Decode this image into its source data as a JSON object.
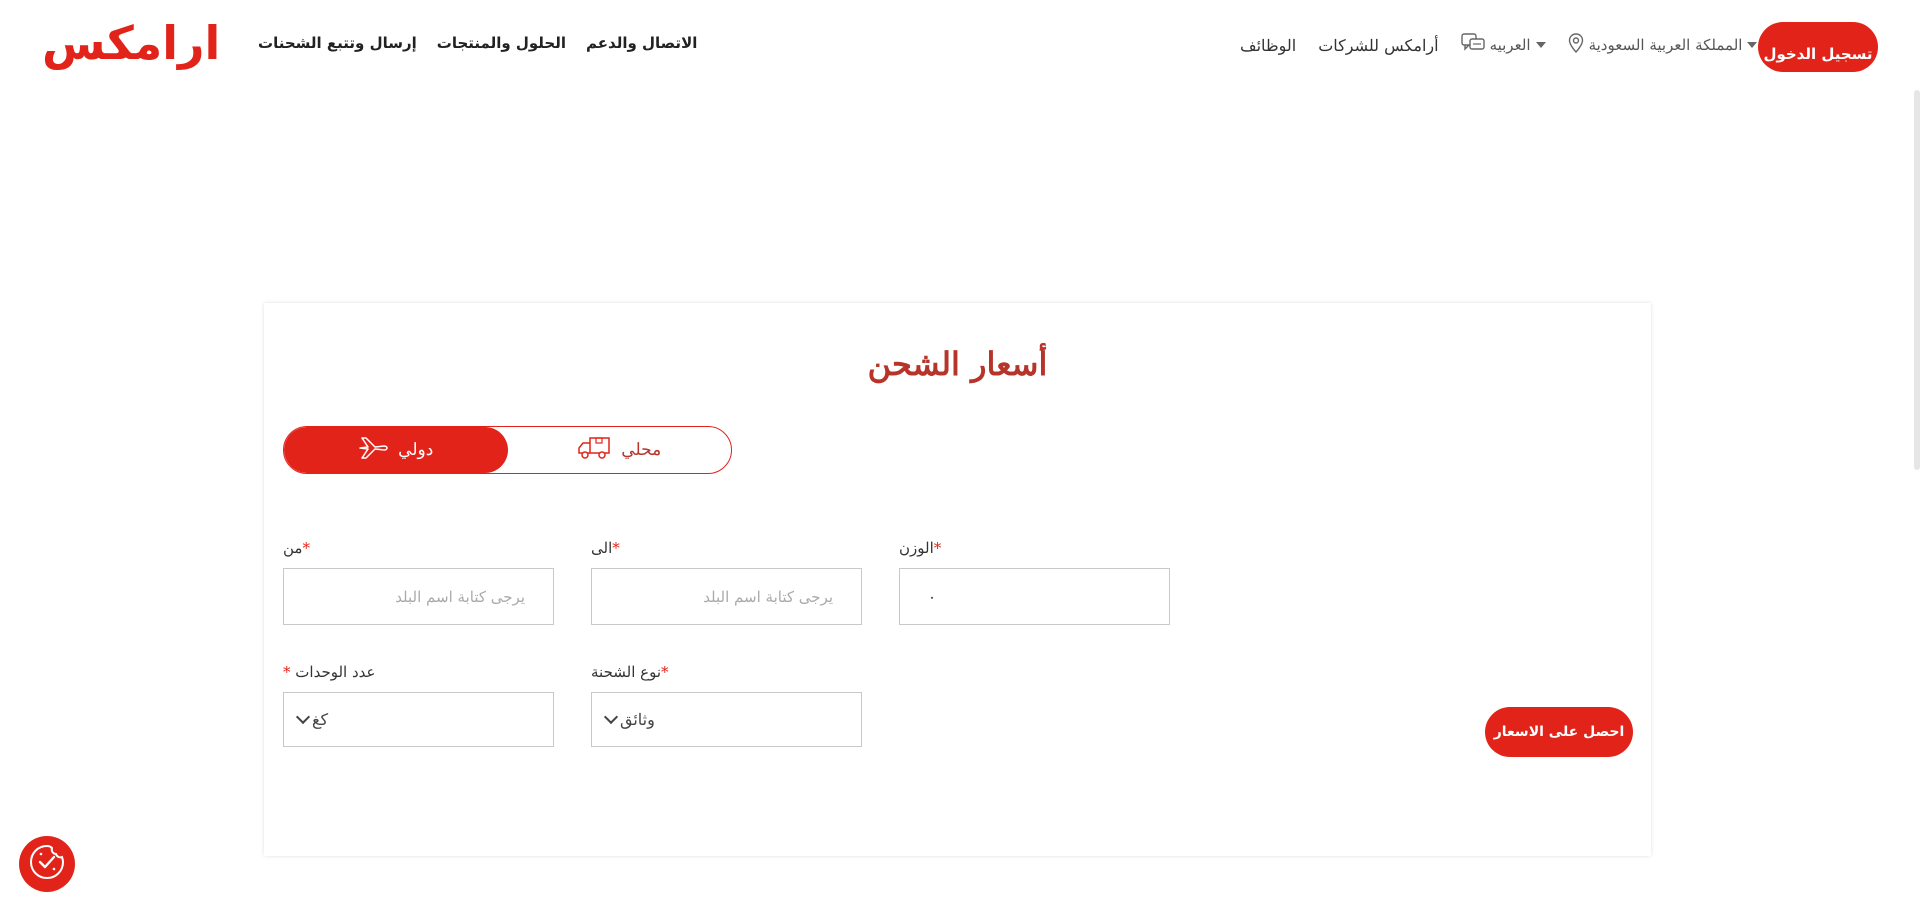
{
  "header": {
    "logo_text": "ارامكس",
    "main_nav": [
      "إرسال وتتبع الشحنات",
      "الحلول والمنتجات",
      "الاتصال والدعم"
    ],
    "util_links": {
      "jobs": "الوظائف",
      "business": "أرامكس للشركات",
      "language": "العربيه",
      "country": "المملكة العربية السعودية"
    },
    "login_label": "تسجيل الدخول"
  },
  "form": {
    "title": "أسعار الشحن",
    "toggle": {
      "international": "دولي",
      "domestic": "محلي",
      "selected": "international"
    },
    "from": {
      "label": "من",
      "placeholder": "يرجى كتابة اسم البلد"
    },
    "to": {
      "label": "الى",
      "placeholder": "يرجى كتابة اسم البلد"
    },
    "weight": {
      "label": "الوزن",
      "value": "٠"
    },
    "units": {
      "label": "عدد الوحدات",
      "value": "كغ"
    },
    "shipment_type": {
      "label": "نوع الشحنة",
      "value": "وثائق"
    },
    "required_mark": "*",
    "submit_label": "احصل على الاسعار"
  },
  "colors": {
    "brand": "#e2231a",
    "title": "#b7342a"
  },
  "icons": [
    "location-pin-icon",
    "language-icon",
    "plane-icon",
    "truck-icon",
    "cookie-consent-icon",
    "chevron-down-icon"
  ]
}
